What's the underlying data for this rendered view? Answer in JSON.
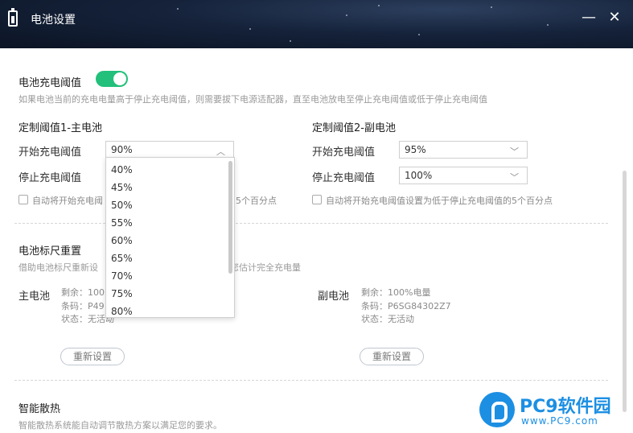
{
  "window": {
    "title": "电池设置",
    "minimize": "—",
    "close": "✕"
  },
  "threshold": {
    "title": "电池充电阈值",
    "toggle_on": true,
    "description": "如果电池当前的充电电量高于停止充电阈值，则需要拔下电源适配器，直至电池放电至停止充电阈值或低于停止充电阈值"
  },
  "main_battery": {
    "title": "定制阈值1-主电池",
    "start_label": "开始充电阈值",
    "start_value": "90%",
    "stop_label": "停止充电阈值",
    "auto_text_left": "自动将开始充电阈",
    "auto_text_right": "5个百分点"
  },
  "sub_battery": {
    "title": "定制阈值2-副电池",
    "start_label": "开始充电阈值",
    "start_value": "95%",
    "stop_label": "停止充电阈值",
    "stop_value": "100%",
    "auto_text": "自动将开始充电阈值设置为低于停止充电阈值的5个百分点"
  },
  "dropdown": {
    "options": [
      "40%",
      "45%",
      "50%",
      "55%",
      "60%",
      "65%",
      "70%",
      "75%",
      "80%"
    ]
  },
  "gauge": {
    "title": "电池标尺重置",
    "desc_left": "借助电池标尺重新设",
    "desc_right": "您估计完全充电量",
    "main": {
      "label": "主电池",
      "remain": "剩余：100",
      "code": "条码：P49",
      "status": "状态：无活动"
    },
    "sub": {
      "label": "副电池",
      "remain": "剩余：100%电量",
      "code": "条码：P6SG84302Z7",
      "status": "状态：无活动"
    },
    "reset_label": "重新设置"
  },
  "cooling": {
    "title": "智能散热",
    "description": "智能散热系统能自动调节散热方案以满足您的要求。"
  },
  "watermark": {
    "brand": "PC9软件园",
    "url": "www.PC9.com"
  },
  "colors": {
    "toggle": "#22c07a",
    "title_bg": "#15223a",
    "brand": "#1c8fe3"
  }
}
